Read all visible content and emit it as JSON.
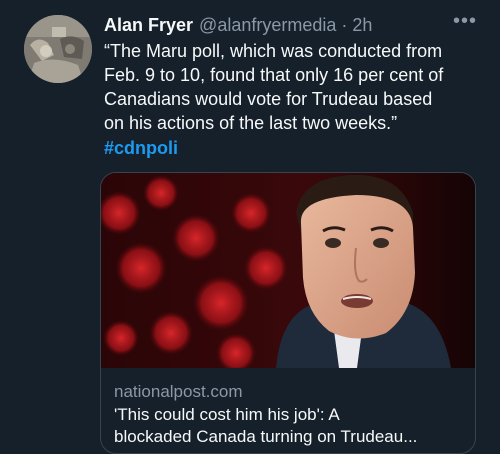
{
  "tweet": {
    "author": {
      "display_name": "Alan Fryer",
      "handle": "@alanfryermedia",
      "separator": "·",
      "time": "2h"
    },
    "more_icon": "more-horizontal-icon",
    "more_label": "•••",
    "text_lines": [
      "“The Maru poll, which was conducted from",
      "Feb. 9 to 10, found that only 16 per cent of",
      "Canadians would vote for Trudeau based",
      "on his actions of the last two weeks.”"
    ],
    "hashtag": "#cdnpoli",
    "link_card": {
      "domain": "nationalpost.com",
      "title_lines": [
        "'This could cost him his job': A",
        "blockaded Canada turning on Trudeau..."
      ]
    }
  },
  "colors": {
    "background": "#15202b",
    "primary_text": "#f7f9f9",
    "secondary_text": "#8b98a5",
    "link": "#1d9bf0",
    "border": "#38444d"
  }
}
